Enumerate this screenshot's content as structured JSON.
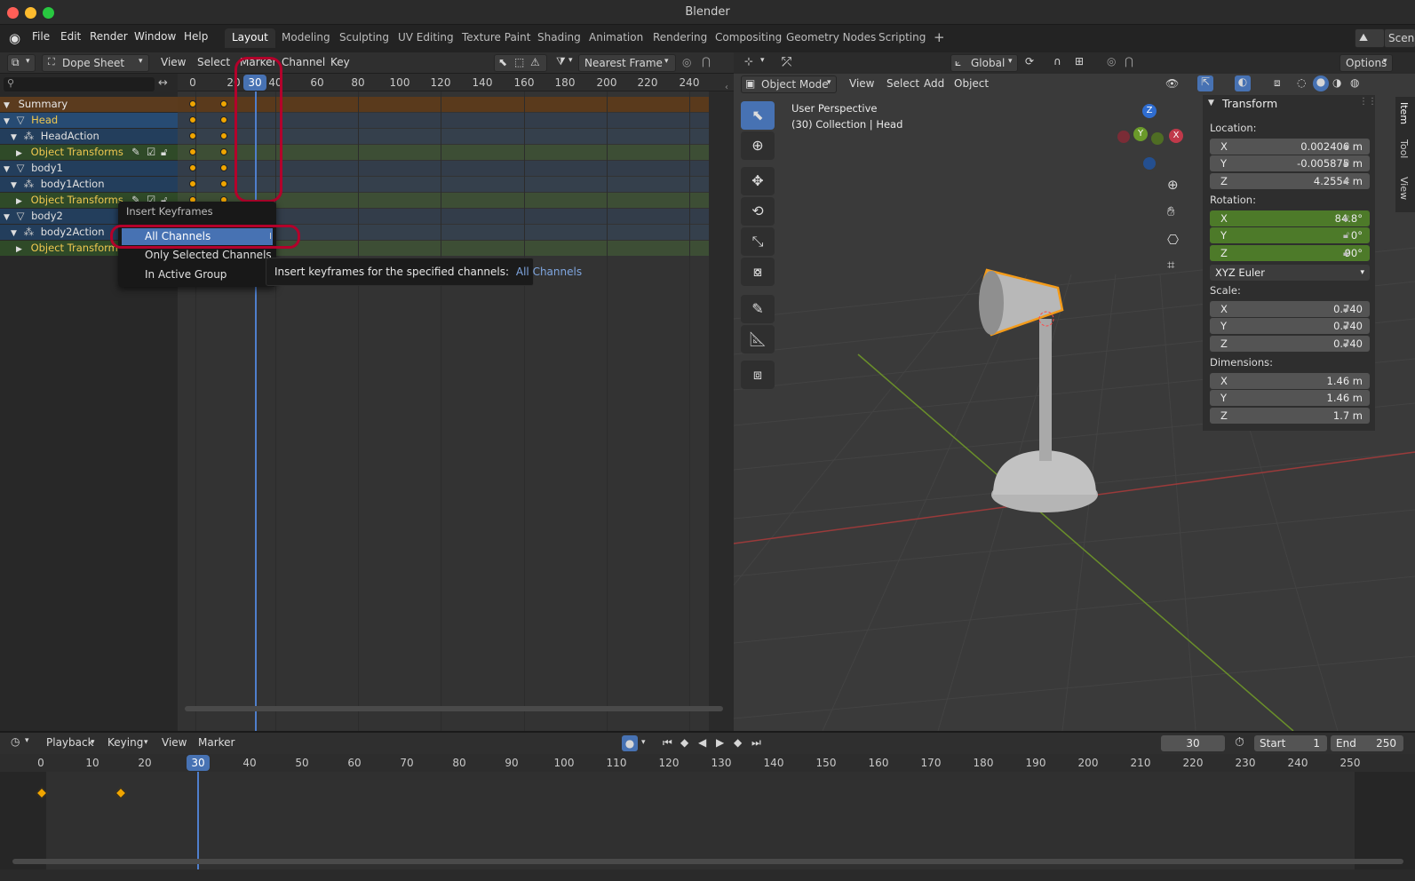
{
  "window": {
    "title": "Blender"
  },
  "menu": [
    "File",
    "Edit",
    "Render",
    "Window",
    "Help"
  ],
  "workspaces": [
    "Layout",
    "Modeling",
    "Sculpting",
    "UV Editing",
    "Texture Paint",
    "Shading",
    "Animation",
    "Rendering",
    "Compositing",
    "Geometry Nodes",
    "Scripting"
  ],
  "scene_label": "Scene",
  "dopesheet": {
    "editor_mode": "Dope Sheet",
    "menus": [
      "View",
      "Select",
      "Marker",
      "Channel",
      "Key"
    ],
    "snap_mode": "Nearest Frame",
    "current_frame": "30",
    "ruler": [
      "0",
      "20",
      "40",
      "60",
      "80",
      "100",
      "120",
      "140",
      "160",
      "180",
      "200",
      "220",
      "240"
    ],
    "channels": [
      {
        "label": "Summary",
        "type": "summary"
      },
      {
        "label": "Head",
        "type": "object"
      },
      {
        "label": "HeadAction",
        "type": "action"
      },
      {
        "label": "Object Transforms",
        "type": "group"
      },
      {
        "label": "body1",
        "type": "object"
      },
      {
        "label": "body1Action",
        "type": "action"
      },
      {
        "label": "Object Transforms",
        "type": "group"
      },
      {
        "label": "body2",
        "type": "object"
      },
      {
        "label": "body2Action",
        "type": "action"
      },
      {
        "label": "Object Transforms",
        "type": "group"
      }
    ]
  },
  "popup": {
    "title": "Insert Keyframes",
    "items": [
      "All Channels",
      "Only Selected Channels",
      "In Active Group"
    ],
    "shortcut": "I",
    "tooltip_text": "Insert keyframes for the specified channels:",
    "tooltip_value": "All Channels"
  },
  "viewport": {
    "mode": "Object Mode",
    "menus": [
      "View",
      "Select",
      "Add",
      "Object"
    ],
    "orientation": "Global",
    "options_label": "Options",
    "perspective": "User Perspective",
    "collection": "(30) Collection | Head",
    "gizmo": {
      "z": "Z",
      "y": "Y",
      "x": "X"
    },
    "tabs": [
      "Item",
      "Tool",
      "View"
    ]
  },
  "transform": {
    "title": "Transform",
    "location_label": "Location:",
    "location": [
      {
        "axis": "X",
        "value": "0.002406 m"
      },
      {
        "axis": "Y",
        "value": "-0.005875 m"
      },
      {
        "axis": "Z",
        "value": "4.2554 m"
      }
    ],
    "rotation_label": "Rotation:",
    "rotation": [
      {
        "axis": "X",
        "value": "84.8°"
      },
      {
        "axis": "Y",
        "value": "0°"
      },
      {
        "axis": "Z",
        "value": "90°"
      }
    ],
    "rotation_mode": "XYZ Euler",
    "scale_label": "Scale:",
    "scale": [
      {
        "axis": "X",
        "value": "0.740"
      },
      {
        "axis": "Y",
        "value": "0.740"
      },
      {
        "axis": "Z",
        "value": "0.740"
      }
    ],
    "dimensions_label": "Dimensions:",
    "dimensions": [
      {
        "axis": "X",
        "value": "1.46 m"
      },
      {
        "axis": "Y",
        "value": "1.46 m"
      },
      {
        "axis": "Z",
        "value": "1.7 m"
      }
    ]
  },
  "timeline": {
    "menus": [
      "Playback",
      "Keying",
      "View",
      "Marker"
    ],
    "current_frame": "30",
    "start_label": "Start",
    "start": "1",
    "end_label": "End",
    "end": "250",
    "ruler": [
      "0",
      "10",
      "20",
      "40",
      "50",
      "60",
      "70",
      "80",
      "90",
      "100",
      "110",
      "120",
      "130",
      "140",
      "150",
      "160",
      "170",
      "180",
      "190",
      "200",
      "210",
      "220",
      "230",
      "240",
      "250"
    ],
    "playhead_label": "30"
  },
  "colors": {
    "accent": "#4772b3",
    "keyframe": "#f0a500",
    "highlight_red": "#b3002b",
    "green_field": "#4d7a29"
  }
}
